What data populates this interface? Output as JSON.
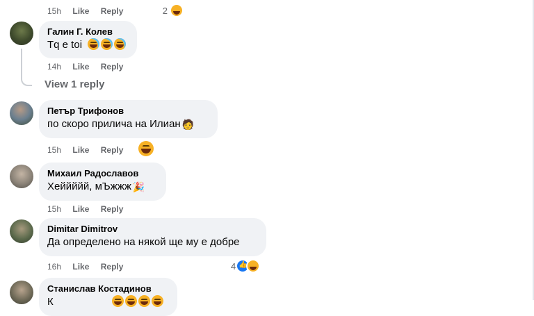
{
  "top_row": {
    "time": "15h",
    "like": "Like",
    "reply": "Reply",
    "reaction_count": "2"
  },
  "comments": [
    {
      "author": "Галин Г. Колев",
      "text": "Tq e toi",
      "time": "14h",
      "like": "Like",
      "reply": "Reply"
    },
    {
      "author": "Петър Трифонов",
      "text": "по скоро прилича на Илиан",
      "time": "15h",
      "like": "Like",
      "reply": "Reply"
    },
    {
      "author": "Михаил Радославов",
      "text": "Хеййййй, мЪжжж",
      "time": "15h",
      "like": "Like",
      "reply": "Reply"
    },
    {
      "author": "Dimitar Dimitrov",
      "text": "Да определено на някой ще му е добре",
      "time": "16h",
      "like": "Like",
      "reply": "Reply",
      "reaction_count": "4"
    },
    {
      "author": "Станислав Костадинов",
      "text": "К",
      "time": "",
      "like": "",
      "reply": ""
    }
  ],
  "view_replies": "View 1 reply",
  "colors": {
    "bubble": "#f0f2f5",
    "meta": "#65676b",
    "like_blue": "#1877f2",
    "emoji_yellow": "#f7b125"
  }
}
